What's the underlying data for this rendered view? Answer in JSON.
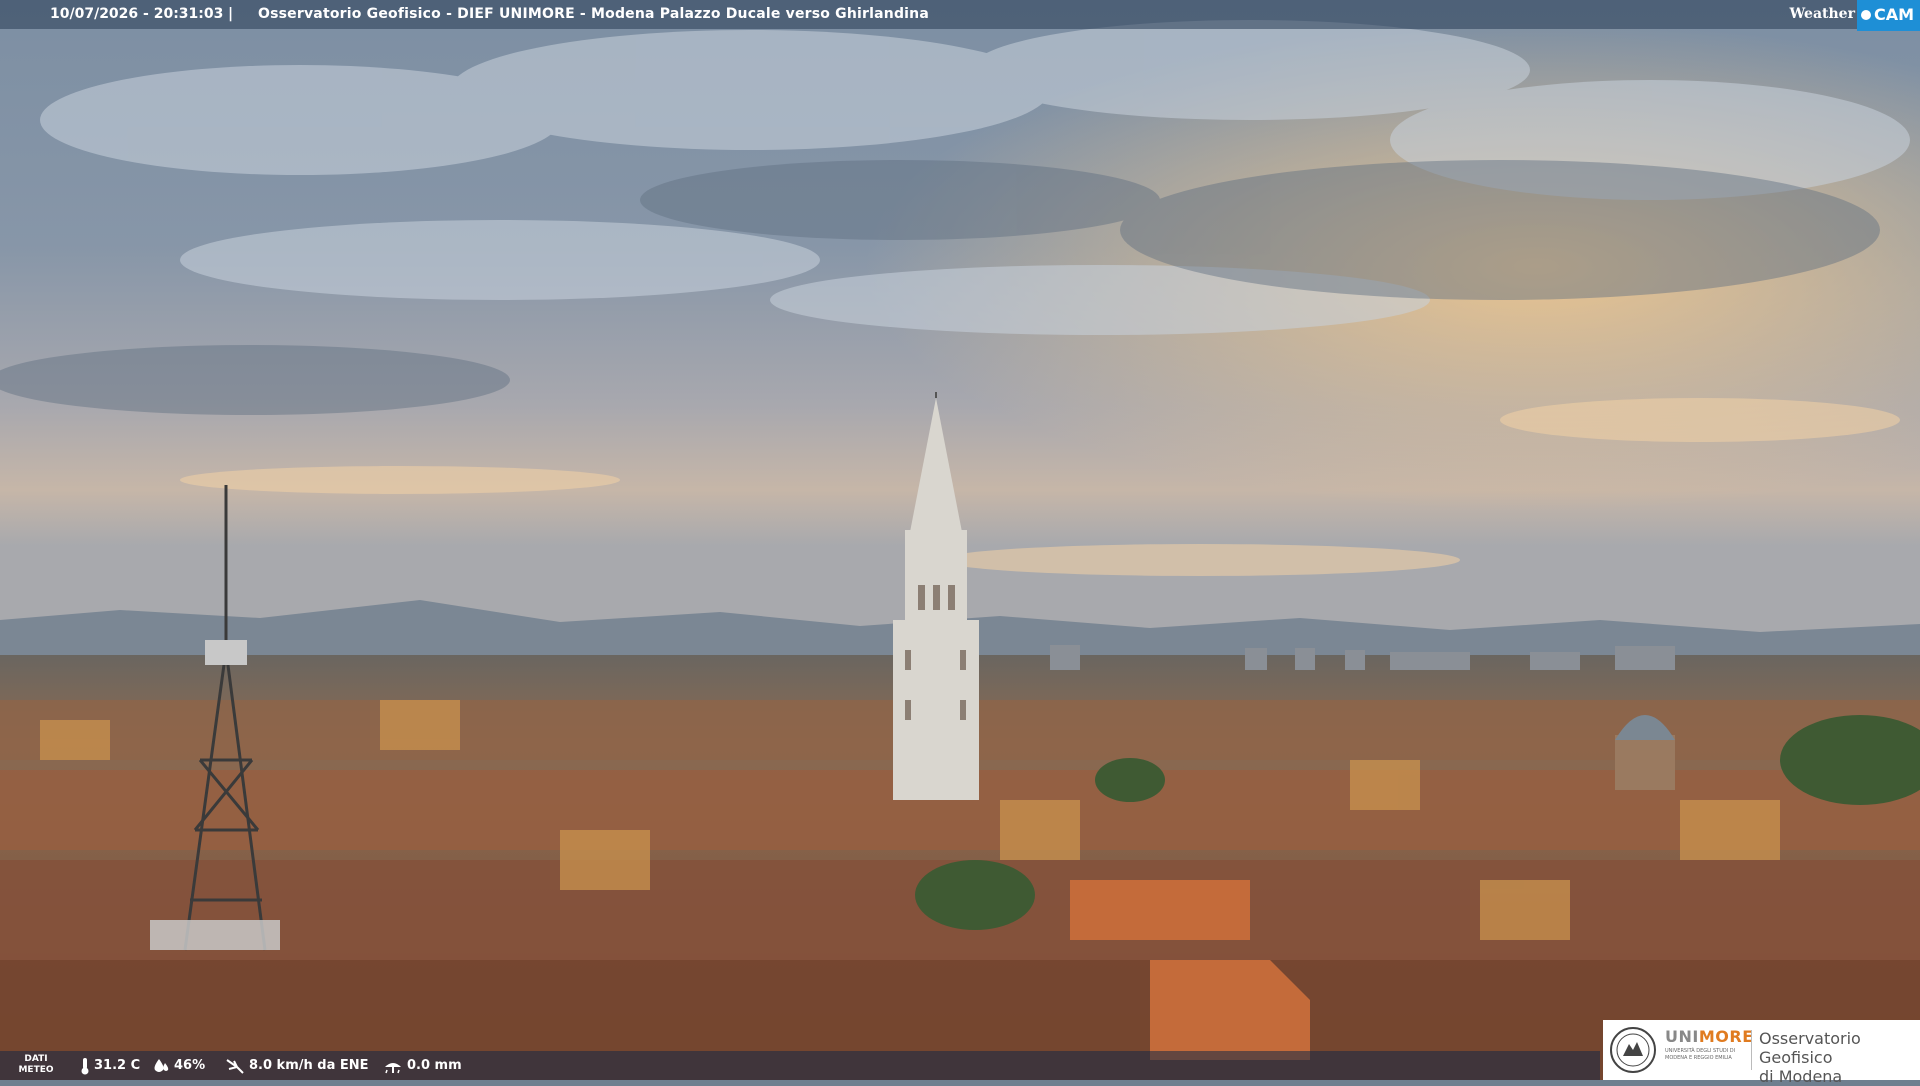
{
  "overlay": {
    "datetime": "10/07/2026 - 20:31:03",
    "separator": "|",
    "location": "Osservatorio Geofisico - DIEF UNIMORE - Modena Palazzo Ducale verso Ghirlandina"
  },
  "watermark": {
    "weather": "Weather",
    "cam": "CAM"
  },
  "meteo": {
    "label_line1": "DATI",
    "label_line2": "METEO",
    "temperature": "31.2 C",
    "humidity": "46%",
    "wind": "8.0 km/h da ENE",
    "rain": "0.0 mm",
    "icons": [
      "thermometer-icon",
      "humidity-drop-icon",
      "wind-icon",
      "rain-gauge-icon"
    ]
  },
  "logo": {
    "brand_prefix": "UNI",
    "brand_suffix": "MORE",
    "brand_subtitle": "UNIVERSITÀ DEGLI STUDI DI MODENA E REGGIO EMILIA",
    "observatory_line1": "Osservatorio Geofisico",
    "observatory_line2": "di Modena"
  },
  "colors": {
    "overlay_bar": "#283c55",
    "cam_badge": "#1e8fd6",
    "brand_orange": "#e07b20"
  }
}
